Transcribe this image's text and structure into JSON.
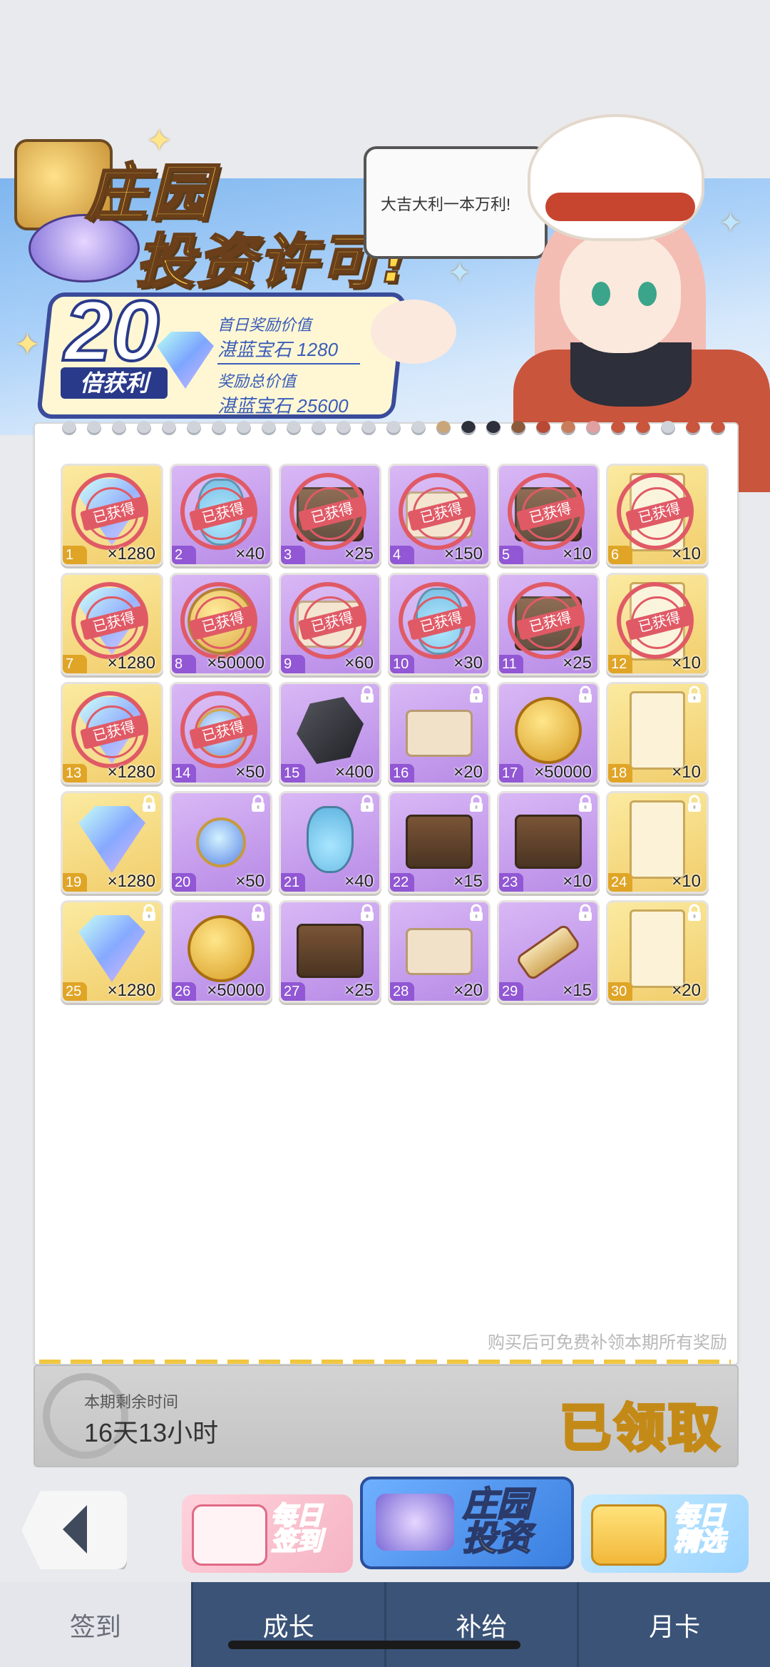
{
  "banner": {
    "title_line1": "庄园",
    "title_line2": "投资许可!",
    "multiplier": "20",
    "multiplier_label": "倍获利",
    "first_day_label": "首日奖励价值",
    "first_day_value": "湛蓝宝石 1280",
    "total_label": "奖励总价值",
    "total_value": "湛蓝宝石 25600"
  },
  "speech": "大吉大利一本万利!",
  "stamp_text": "已获得",
  "items": [
    {
      "num": "1",
      "qty": "×1280",
      "bg": "gold",
      "claimed": true,
      "icon": "gem"
    },
    {
      "num": "2",
      "qty": "×40",
      "bg": "purple",
      "claimed": true,
      "icon": "potion"
    },
    {
      "num": "3",
      "qty": "×25",
      "bg": "purple",
      "claimed": true,
      "icon": "chest"
    },
    {
      "num": "4",
      "qty": "×150",
      "bg": "purple",
      "claimed": true,
      "icon": "box"
    },
    {
      "num": "5",
      "qty": "×10",
      "bg": "purple",
      "claimed": true,
      "icon": "chest"
    },
    {
      "num": "6",
      "qty": "×10",
      "bg": "gold",
      "claimed": true,
      "icon": "ticket"
    },
    {
      "num": "7",
      "qty": "×1280",
      "bg": "gold",
      "claimed": true,
      "icon": "gem"
    },
    {
      "num": "8",
      "qty": "×50000",
      "bg": "purple",
      "claimed": true,
      "icon": "coin"
    },
    {
      "num": "9",
      "qty": "×60",
      "bg": "purple",
      "claimed": true,
      "icon": "box"
    },
    {
      "num": "10",
      "qty": "×30",
      "bg": "purple",
      "claimed": true,
      "icon": "potion"
    },
    {
      "num": "11",
      "qty": "×25",
      "bg": "purple",
      "claimed": true,
      "icon": "chest"
    },
    {
      "num": "12",
      "qty": "×10",
      "bg": "gold",
      "claimed": true,
      "icon": "ticket"
    },
    {
      "num": "13",
      "qty": "×1280",
      "bg": "gold",
      "claimed": true,
      "icon": "gem"
    },
    {
      "num": "14",
      "qty": "×50",
      "bg": "purple",
      "claimed": true,
      "icon": "amulet"
    },
    {
      "num": "15",
      "qty": "×400",
      "bg": "purple",
      "claimed": false,
      "icon": "rock"
    },
    {
      "num": "16",
      "qty": "×20",
      "bg": "purple",
      "claimed": false,
      "icon": "box"
    },
    {
      "num": "17",
      "qty": "×50000",
      "bg": "purple",
      "claimed": false,
      "icon": "coin"
    },
    {
      "num": "18",
      "qty": "×10",
      "bg": "gold",
      "claimed": false,
      "icon": "ticket"
    },
    {
      "num": "19",
      "qty": "×1280",
      "bg": "gold",
      "claimed": false,
      "icon": "gem"
    },
    {
      "num": "20",
      "qty": "×50",
      "bg": "purple",
      "claimed": false,
      "icon": "amulet"
    },
    {
      "num": "21",
      "qty": "×40",
      "bg": "purple",
      "claimed": false,
      "icon": "potion"
    },
    {
      "num": "22",
      "qty": "×15",
      "bg": "purple",
      "claimed": false,
      "icon": "chest"
    },
    {
      "num": "23",
      "qty": "×10",
      "bg": "purple",
      "claimed": false,
      "icon": "chest"
    },
    {
      "num": "24",
      "qty": "×10",
      "bg": "gold",
      "claimed": false,
      "icon": "ticket"
    },
    {
      "num": "25",
      "qty": "×1280",
      "bg": "gold",
      "claimed": false,
      "icon": "gem"
    },
    {
      "num": "26",
      "qty": "×50000",
      "bg": "purple",
      "claimed": false,
      "icon": "coin"
    },
    {
      "num": "27",
      "qty": "×25",
      "bg": "purple",
      "claimed": false,
      "icon": "chest"
    },
    {
      "num": "28",
      "qty": "×20",
      "bg": "purple",
      "claimed": false,
      "icon": "box"
    },
    {
      "num": "29",
      "qty": "×15",
      "bg": "purple",
      "claimed": false,
      "icon": "scroll"
    },
    {
      "num": "30",
      "qty": "×20",
      "bg": "gold",
      "claimed": false,
      "icon": "ticket"
    }
  ],
  "hint": "购买后可免费补领本期所有奖励",
  "timer": {
    "label": "本期剩余时间",
    "value": "16天13小时"
  },
  "claim_status": "已领取",
  "features": {
    "daily_checkin": "每日\n签到",
    "estate_invest": "庄园\n投资",
    "daily_pick": "每日\n精选"
  },
  "nav": [
    "签到",
    "成长",
    "补给",
    "月卡"
  ],
  "colors": {
    "gold_tile": "#f1cd6b",
    "purple_tile": "#b78ae6",
    "stamp": "#e05a66",
    "nav_bg": "#3a5377"
  }
}
